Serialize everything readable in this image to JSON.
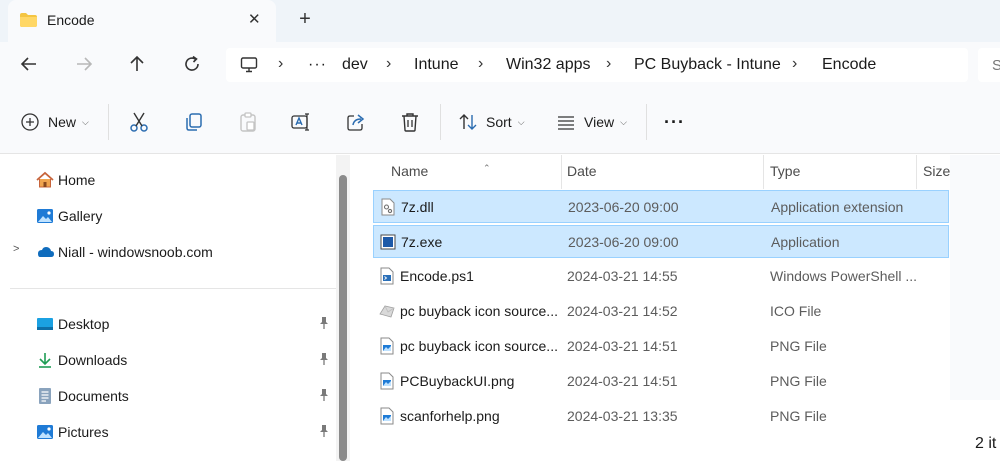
{
  "tab": {
    "title": "Encode",
    "icon": "folder-icon",
    "close_glyph": "✕",
    "new_tab_glyph": "+"
  },
  "nav": {
    "back_icon": "back-arrow-icon",
    "forward_icon": "forward-arrow-icon",
    "up_icon": "up-arrow-icon",
    "refresh_icon": "refresh-icon",
    "breadcrumbs": [
      "dev",
      "Intune",
      "Win32 apps",
      "PC Buyback - Intune",
      "Encode"
    ],
    "overflow": "···",
    "search_placeholder": "S"
  },
  "commands": {
    "new_label": "New",
    "sort_label": "Sort",
    "view_label": "View",
    "more_glyph": "···"
  },
  "sidebar": {
    "items": [
      {
        "label": "Home",
        "icon": "home-icon"
      },
      {
        "label": "Gallery",
        "icon": "gallery-icon"
      },
      {
        "label": "Niall - windowsnoob.com",
        "icon": "onedrive-cloud-icon"
      },
      {
        "label": "Desktop",
        "icon": "desktop-icon"
      },
      {
        "label": "Downloads",
        "icon": "downloads-icon"
      },
      {
        "label": "Documents",
        "icon": "documents-icon"
      },
      {
        "label": "Pictures",
        "icon": "pictures-icon"
      }
    ]
  },
  "files": {
    "columns": {
      "name": "Name",
      "date": "Date",
      "type": "Type",
      "size": "Size"
    },
    "rows": [
      {
        "name": "7z.dll",
        "date": "2023-06-20 09:00",
        "type": "Application extension",
        "selected": true,
        "icon": "dll-file-icon"
      },
      {
        "name": "7z.exe",
        "date": "2023-06-20 09:00",
        "type": "Application",
        "selected": true,
        "icon": "exe-file-icon"
      },
      {
        "name": "Encode.ps1",
        "date": "2024-03-21 14:55",
        "type": "Windows PowerShell ...",
        "selected": false,
        "icon": "powershell-file-icon"
      },
      {
        "name": "pc buyback icon source...",
        "date": "2024-03-21 14:52",
        "type": "ICO File",
        "selected": false,
        "icon": "ico-file-icon"
      },
      {
        "name": "pc buyback icon source...",
        "date": "2024-03-21 14:51",
        "type": "PNG File",
        "selected": false,
        "icon": "png-file-icon"
      },
      {
        "name": "PCBuybackUI.png",
        "date": "2024-03-21 14:51",
        "type": "PNG File",
        "selected": false,
        "icon": "png-file-icon"
      },
      {
        "name": "scanforhelp.png",
        "date": "2024-03-21 13:35",
        "type": "PNG File",
        "selected": false,
        "icon": "png-file-icon"
      }
    ]
  },
  "details": {
    "status": "2 it"
  },
  "colors": {
    "selection": "#cce8ff",
    "selection_border": "#99d1ff",
    "folder": "#f4c542",
    "accent": "#0067c0"
  }
}
